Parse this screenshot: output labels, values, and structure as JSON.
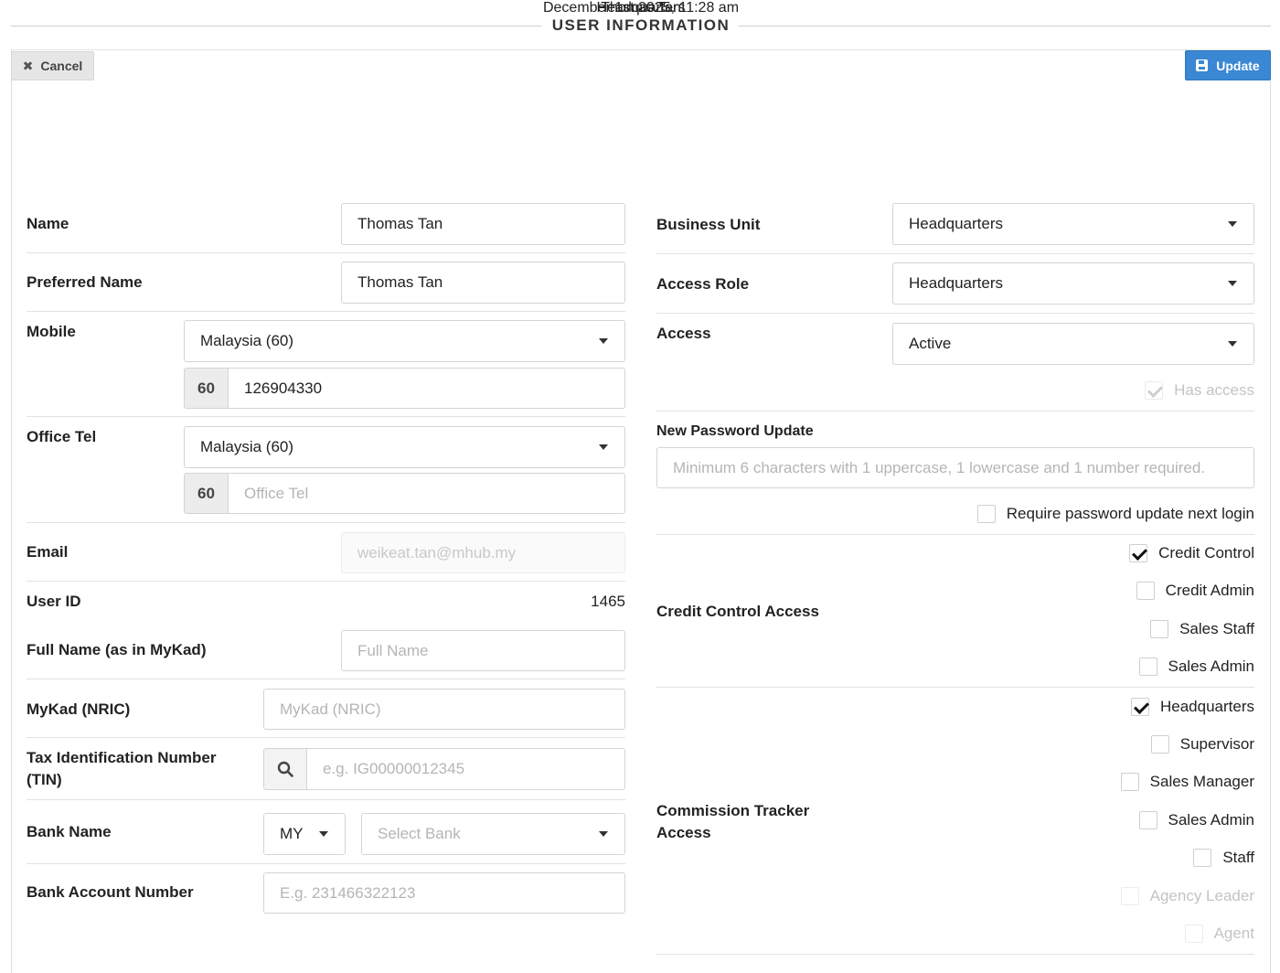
{
  "header": {
    "title": "USER INFORMATION"
  },
  "toolbar": {
    "cancel_label": "Cancel",
    "update_label": "Update"
  },
  "profile": {
    "name": "Thomas Tan",
    "business_unit": "Headquarters",
    "timestamp": "December 1st 2025, 11:28 am"
  },
  "left": {
    "name": {
      "label": "Name",
      "value": "Thomas Tan"
    },
    "preferred_name": {
      "label": "Preferred Name",
      "value": "Thomas Tan"
    },
    "mobile": {
      "label": "Mobile",
      "country": "Malaysia (60)",
      "prefix": "60",
      "number": "126904330"
    },
    "office_tel": {
      "label": "Office Tel",
      "country": "Malaysia (60)",
      "prefix": "60",
      "placeholder": "Office Tel"
    },
    "email": {
      "label": "Email",
      "value": "weikeat.tan@mhub.my"
    },
    "user_id": {
      "label": "User ID",
      "value": "1465"
    },
    "full_name": {
      "label": "Full Name (as in MyKad)",
      "placeholder": "Full Name"
    },
    "mykad": {
      "label": "MyKad (NRIC)",
      "placeholder": "MyKad (NRIC)"
    },
    "tin": {
      "label_line1": "Tax Identification Number",
      "label_line2": "(TIN)",
      "placeholder": "e.g. IG00000012345"
    },
    "bank_name": {
      "label": "Bank Name",
      "country": "MY",
      "placeholder": "Select Bank"
    },
    "bank_account": {
      "label": "Bank Account Number",
      "placeholder": "E.g. 231466322123"
    }
  },
  "right": {
    "business_unit": {
      "label": "Business Unit",
      "value": "Headquarters"
    },
    "access_role": {
      "label": "Access Role",
      "value": "Headquarters"
    },
    "access": {
      "label": "Access",
      "value": "Active",
      "has_access_label": "Has access"
    },
    "password": {
      "label": "New Password Update",
      "placeholder": "Minimum 6 characters with 1 uppercase, 1 lowercase and 1 number required.",
      "require_label": "Require password update next login"
    },
    "credit_control": {
      "label": "Credit Control Access",
      "options": [
        {
          "label": "Credit Control",
          "checked": true
        },
        {
          "label": "Credit Admin",
          "checked": false
        },
        {
          "label": "Sales Staff",
          "checked": false
        },
        {
          "label": "Sales Admin",
          "checked": false
        }
      ]
    },
    "commission": {
      "label_line1": "Commission Tracker",
      "label_line2": "Access",
      "options": [
        {
          "label": "Headquarters",
          "checked": true
        },
        {
          "label": "Supervisor",
          "checked": false
        },
        {
          "label": "Sales Manager",
          "checked": false
        },
        {
          "label": "Sales Admin",
          "checked": false
        },
        {
          "label": "Staff",
          "checked": false
        },
        {
          "label": "Agency Leader",
          "checked": false
        },
        {
          "label": "Agent",
          "checked": false
        }
      ]
    }
  }
}
